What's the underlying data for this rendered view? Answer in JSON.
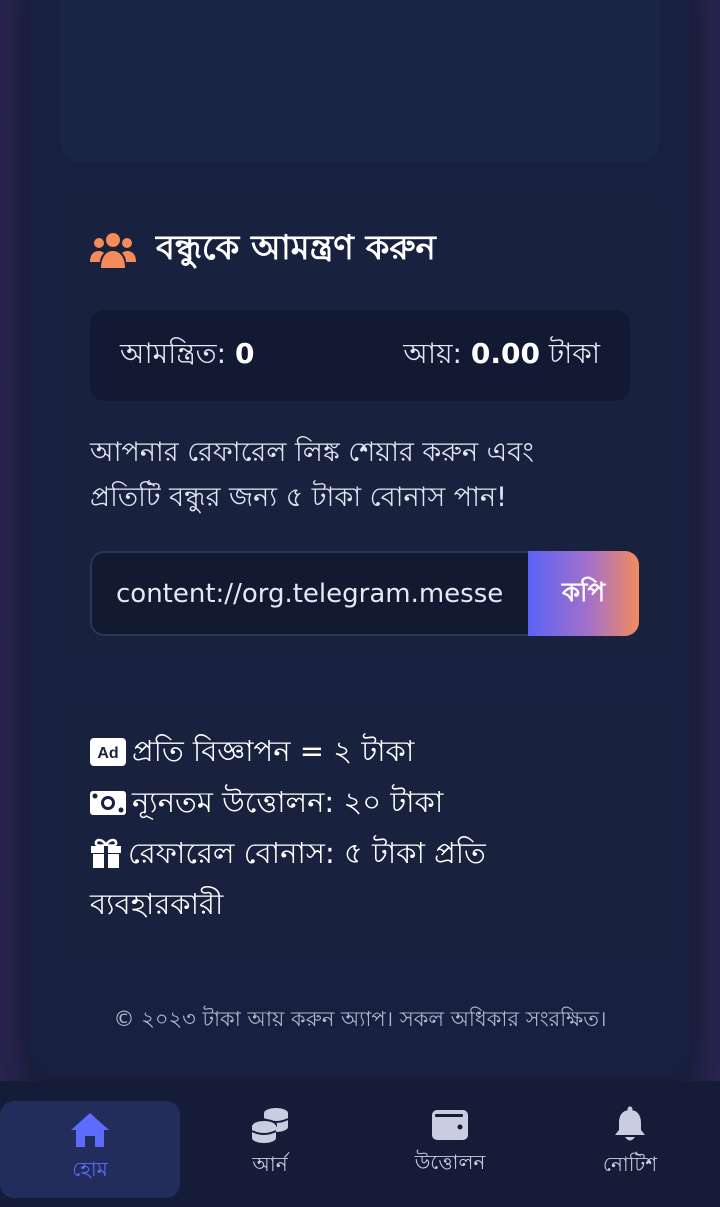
{
  "invite": {
    "title": "বন্ধুকে আমন্ত্রণ করুন",
    "invited_label": "আমন্ত্রিত:",
    "invited_count": "0",
    "earning_label": "আয়:",
    "earning_amount": "0.00",
    "earning_currency": "টাকা",
    "description": "আপনার রেফারেল লিঙ্ক শেয়ার করুন এবং প্রতিটি বন্ধুর জন্য ৫ টাকা বোনাস পান!",
    "referral_link": "content://org.telegram.messenger.provider",
    "copy_label": "কপি"
  },
  "info": {
    "items": [
      {
        "icon": "ad-icon",
        "text": "প্রতি বিজ্ঞাপন = ২ টাকা"
      },
      {
        "icon": "money-bill-icon",
        "text": "ন্যূনতম উত্তোলন: ২০ টাকা"
      },
      {
        "icon": "gift-icon",
        "text": "রেফারেল বোনাস: ৫ টাকা প্রতি ব্যবহারকারী"
      }
    ]
  },
  "footer": {
    "text": "© ২০২৩ টাকা আয় করুন অ্যাপ। সকল অধিকার সংরক্ষিত।"
  },
  "nav": {
    "items": [
      {
        "icon": "home-icon",
        "label": "হোম",
        "active": true
      },
      {
        "icon": "coins-icon",
        "label": "আর্ন",
        "active": false
      },
      {
        "icon": "wallet-icon",
        "label": "উত্তোলন",
        "active": false
      },
      {
        "icon": "bell-icon",
        "label": "নোটিশ",
        "active": false
      }
    ]
  },
  "colors": {
    "accent": "#5d6bff",
    "icon_orange": "#f58a5b",
    "background": "#172040"
  }
}
